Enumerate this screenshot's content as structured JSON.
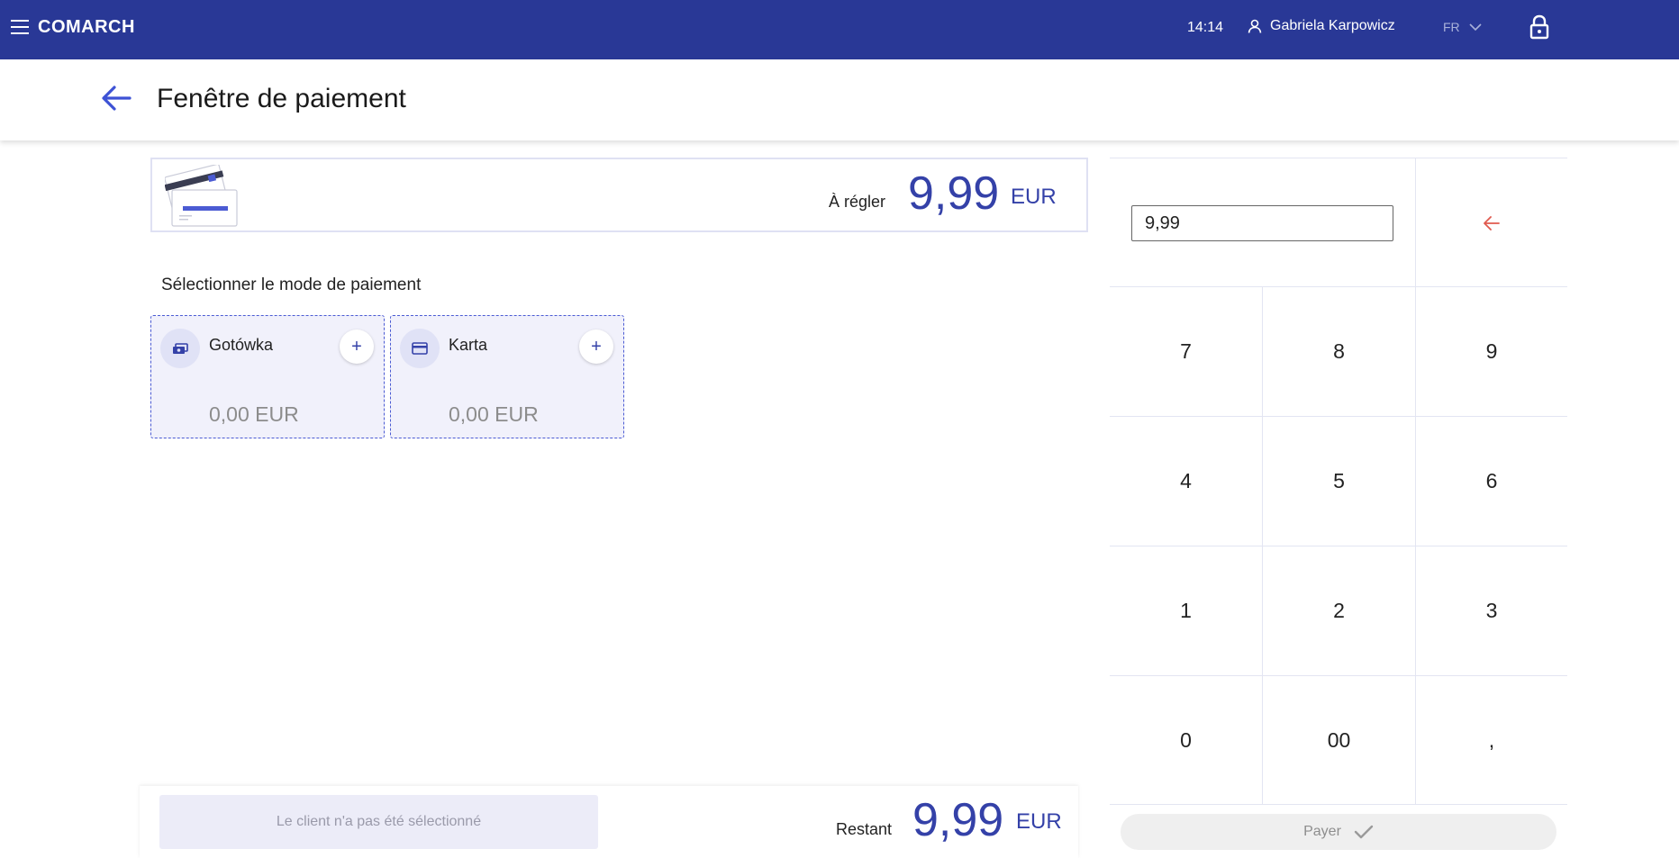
{
  "topbar": {
    "brand": "COMARCH",
    "time": "14:14",
    "user_name": "Gabriela Karpowicz",
    "language": "FR"
  },
  "header": {
    "title": "Fenêtre de paiement"
  },
  "amount_due": {
    "label": "À régler",
    "value": "9,99",
    "currency": "EUR"
  },
  "payment_section": {
    "title": "Sélectionner le mode de paiement",
    "methods": [
      {
        "name": "Gotówka",
        "amount": "0,00 EUR",
        "icon": "cash-icon"
      },
      {
        "name": "Karta",
        "amount": "0,00 EUR",
        "icon": "card-icon"
      }
    ]
  },
  "keypad": {
    "input_value": "9,99",
    "keys": [
      "7",
      "8",
      "9",
      "4",
      "5",
      "6",
      "1",
      "2",
      "3",
      "0",
      "00",
      ","
    ]
  },
  "bottom": {
    "client_label": "Le client n'a pas été sélectionné",
    "remaining_label": "Restant",
    "remaining_value": "9,99",
    "remaining_currency": "EUR"
  },
  "pay": {
    "label": "Payer"
  },
  "colors": {
    "topbar": "#293896",
    "accent": "#3441a8",
    "backspace": "#e05a4f"
  }
}
